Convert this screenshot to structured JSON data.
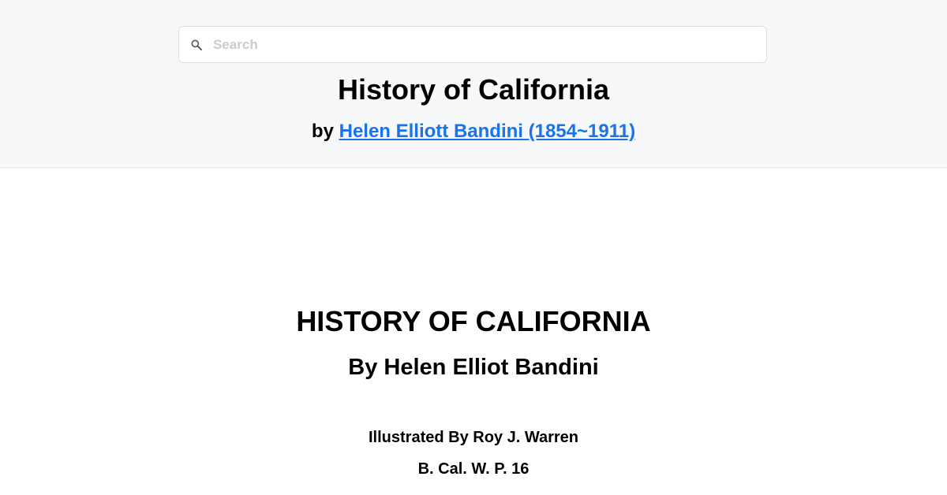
{
  "header": {
    "search": {
      "placeholder": "Search",
      "value": "",
      "icon": "search-icon"
    },
    "title": "History of California",
    "by_prefix": "by",
    "author_link": "Helen Elliott Bandini (1854~1911)"
  },
  "content": {
    "title": "HISTORY OF CALIFORNIA",
    "author": "By Helen Elliot Bandini",
    "illustrator": "Illustrated By Roy J. Warren",
    "imprint": "B. Cal. W. P. 16"
  },
  "colors": {
    "header_background": "#f7f8fa",
    "link": "#1a73e8",
    "text": "#000000"
  }
}
